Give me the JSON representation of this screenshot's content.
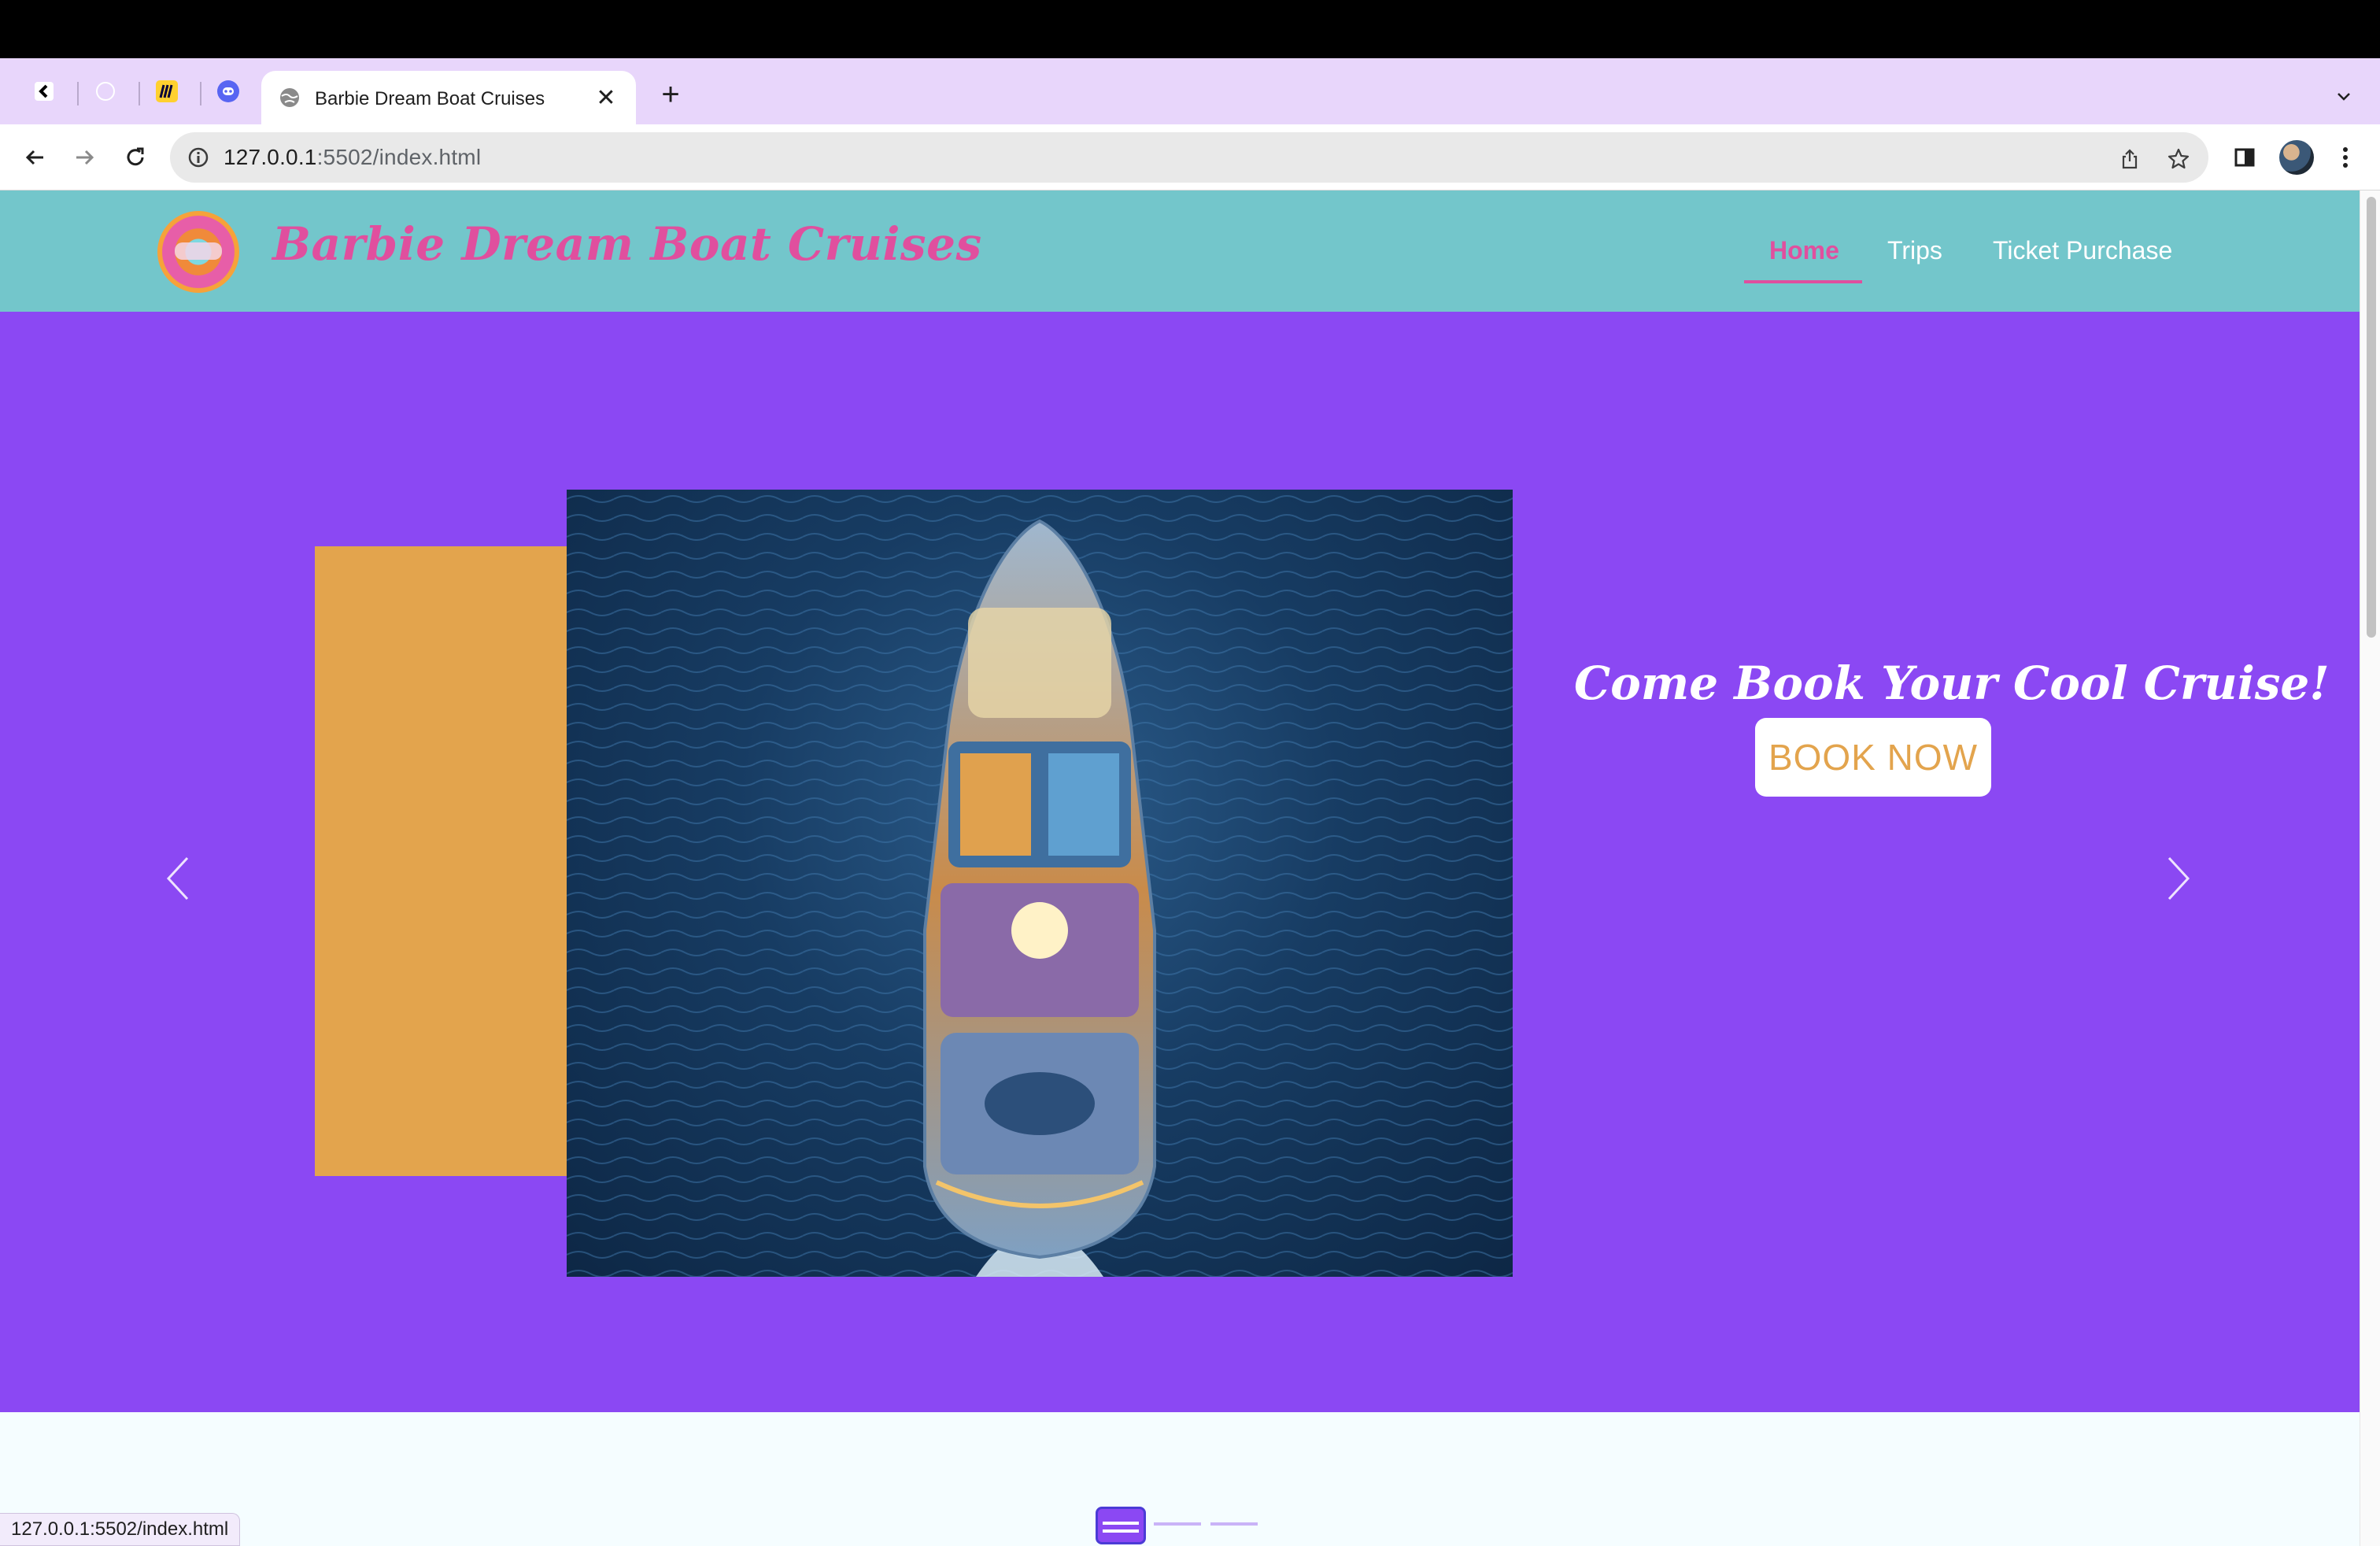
{
  "browser": {
    "tabs": [
      {
        "icon": "back-chevron-icon"
      },
      {
        "icon": "loading-circle-icon"
      },
      {
        "icon": "miro-logo-icon"
      },
      {
        "icon": "discord-logo-icon"
      }
    ],
    "active_tab": {
      "title": "Barbie Dream Boat Cruises",
      "icon": "globe-icon"
    },
    "address": {
      "host": "127.0.0.1",
      "rest": ":5502/index.html"
    },
    "status_url": "127.0.0.1:5502/index.html"
  },
  "site": {
    "brand": "Barbie Dream Boat Cruises",
    "nav": [
      {
        "label": "Home",
        "active": true
      },
      {
        "label": "Trips",
        "active": false
      },
      {
        "label": "Ticket Purchase",
        "active": false
      }
    ]
  },
  "hero": {
    "cta_title": "Come Book Your Cool Cruise!",
    "cta_button": "BOOK NOW",
    "slide_count": 3,
    "active_slide": 1
  },
  "colors": {
    "navbar": "#73c6cb",
    "brand_pink": "#e04f9e",
    "hero_purple": "#8b48f3",
    "accent_orange": "#e3a44d"
  }
}
